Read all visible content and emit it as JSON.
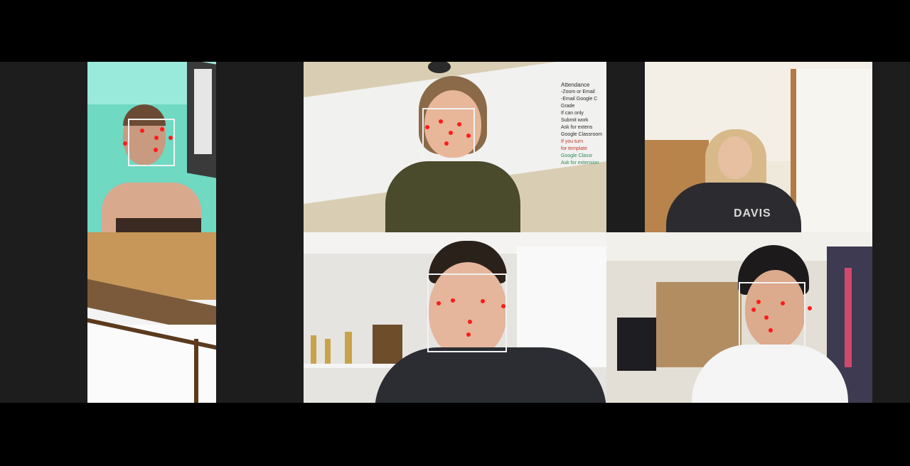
{
  "meeting": {
    "participants": [
      {
        "id": "participant-1",
        "face_detected": true,
        "landmarks": 6,
        "colors": {
          "bg": "#5fcfb8",
          "wall": "#8fe4cf"
        }
      },
      {
        "id": "participant-2",
        "face_detected": true,
        "landmarks": 6,
        "colors": {
          "bg": "#ececec",
          "wall": "#d8cdb3"
        }
      },
      {
        "id": "participant-3",
        "face_detected": false,
        "landmarks": 0,
        "colors": {
          "bg": "#e8e2d3",
          "wall": "#c79a63"
        }
      },
      {
        "id": "participant-4",
        "face_detected": false,
        "landmarks": 0,
        "colors": {
          "bg": "#c89a5e",
          "wall": "#f5f5f5"
        }
      },
      {
        "id": "participant-5",
        "face_detected": true,
        "landmarks": 6,
        "colors": {
          "bg": "#e4e2de",
          "wall": "#d0ccc4"
        }
      },
      {
        "id": "participant-6",
        "face_detected": true,
        "landmarks": 6,
        "colors": {
          "bg": "#d9d6cf",
          "wall": "#b8a588"
        }
      }
    ],
    "whiteboard": {
      "heading": "Attendance",
      "lines": [
        "-Zoom or Email",
        "-Email Google C",
        "Grade",
        "If can only",
        "Submit work",
        "Ask for extens",
        "Google Classroom",
        "If you turn",
        "for template",
        "Google Classr",
        "Ask for extension"
      ]
    },
    "shirt_text": "DAVIS"
  }
}
